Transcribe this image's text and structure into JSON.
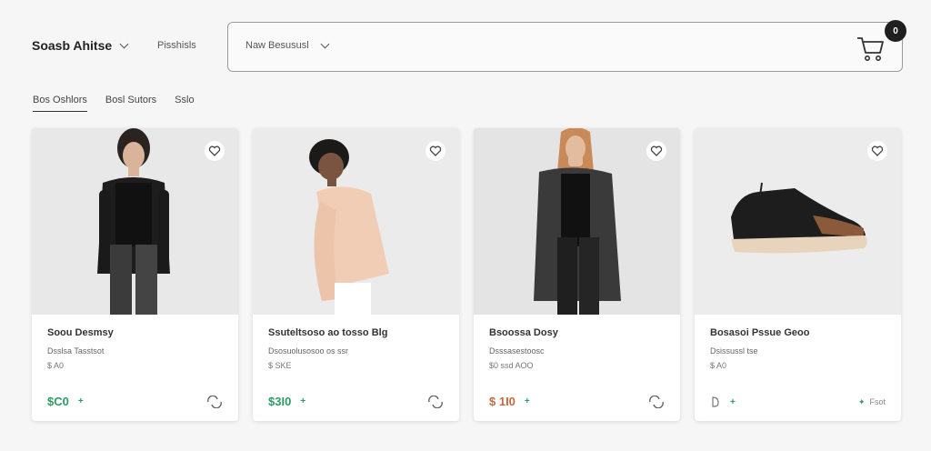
{
  "header": {
    "brand": "Soasb Ahitse",
    "nav_link": "Pisshisls",
    "search_select": "Naw Besususl",
    "cart_count": "0"
  },
  "tabs": [
    {
      "label": "Bos Oshlors"
    },
    {
      "label": "Bosl Sutors"
    },
    {
      "label": "Sslo"
    }
  ],
  "products": [
    {
      "name": "Soou Desmsy",
      "subtitle": "Dsslsa Tasstsot",
      "meta": "$ A0",
      "price": "$C0",
      "plus": "+",
      "price_color": "#2e9b63"
    },
    {
      "name": "Ssuteltsoso ao tosso Blg",
      "subtitle": "Dsosuolusosoo os ssr",
      "meta": "$ SKE",
      "price": "$3I0",
      "plus": "+",
      "price_color": "#2e9b63"
    },
    {
      "name": "Bsoossa Dosy",
      "subtitle": "Dsssasestoosc",
      "meta": "$0 ssd AOO",
      "price": "$ 1I0",
      "plus": "+",
      "price_color": "#c46a3c"
    },
    {
      "name": "Bosasoi Pssue Geoo",
      "subtitle": "Dsissussl tse",
      "meta": "$ A0",
      "price": "",
      "plus": "+",
      "price_color": "#2e9b63",
      "right_text": "Fsot"
    }
  ]
}
